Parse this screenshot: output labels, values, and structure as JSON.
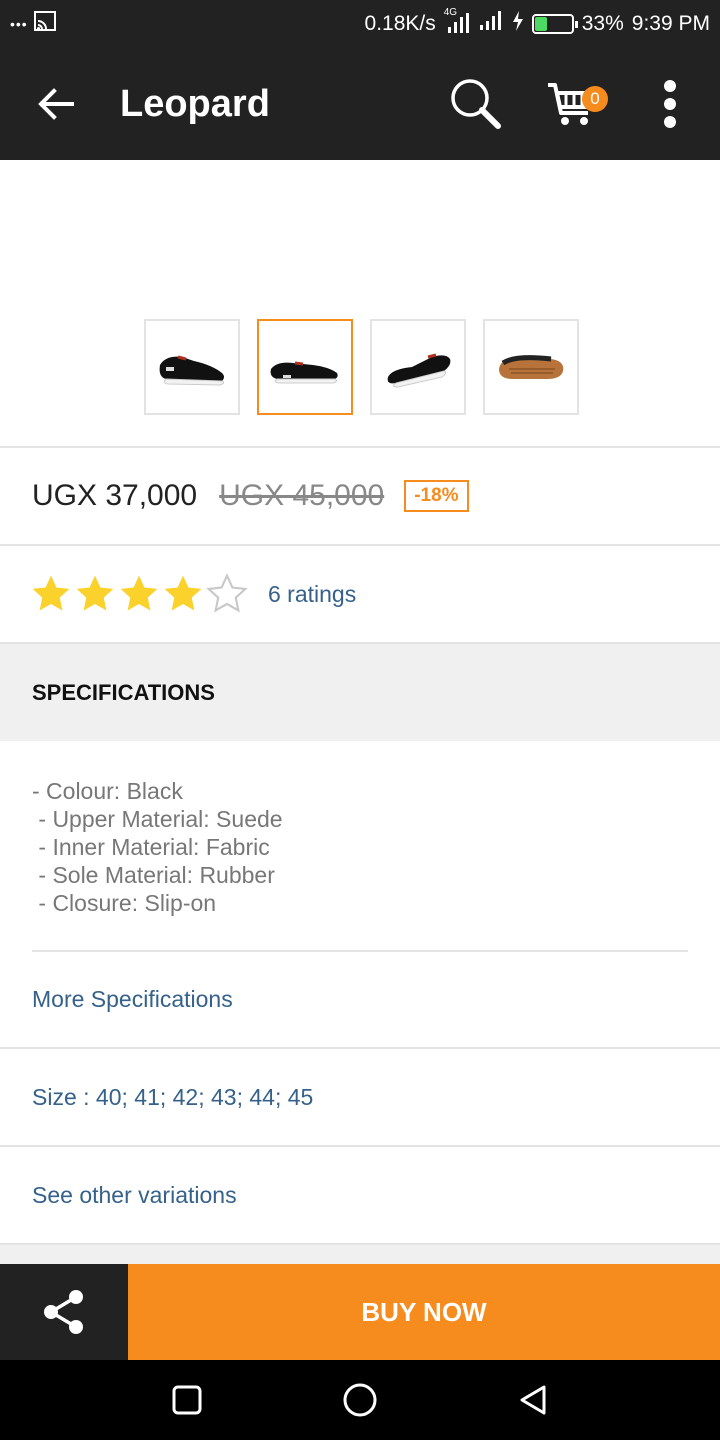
{
  "status_bar": {
    "dots": "•••",
    "network_speed": "0.18K/s",
    "network_type": "4G",
    "battery_percent": "33%",
    "battery_level": 0.33,
    "time": "9:39 PM"
  },
  "app_bar": {
    "title": "Leopard",
    "cart_count": "0"
  },
  "gallery": {
    "thumbnails": [
      "shoe-side-left",
      "shoe-side-angle",
      "shoe-side-right",
      "shoe-sole"
    ],
    "selected_index": 1
  },
  "product": {
    "price": "UGX 37,000",
    "old_price": "UGX 45,000",
    "discount": "-18%",
    "rating": 4,
    "rating_max": 5,
    "ratings_label": "6 ratings"
  },
  "specifications": {
    "header": "SPECIFICATIONS",
    "lines": [
      "- Colour: Black",
      " - Upper Material: Suede",
      " - Inner Material: Fabric",
      " - Sole Material: Rubber",
      " - Closure: Slip-on"
    ],
    "more_link": "More Specifications"
  },
  "size_label": "Size : 40; 41; 42; 43; 44; 45",
  "variations_link": "See other variations",
  "actions": {
    "buy_now": "BUY NOW"
  },
  "colors": {
    "accent": "#f68b1e",
    "dark": "#222222",
    "link": "#35618a",
    "star": "#fbd12b"
  }
}
